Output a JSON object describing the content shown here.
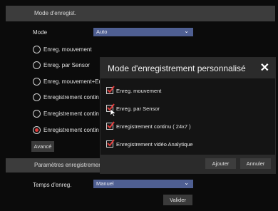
{
  "record_mode_section": {
    "title": "Mode d'enregist.",
    "mode_label": "Mode",
    "mode_value": "Auto",
    "options": [
      {
        "label": "Enreg. mouvement",
        "selected": false
      },
      {
        "label": "Enreg. par Sensor",
        "selected": false
      },
      {
        "label": "Enreg. mouvement+Er",
        "selected": false
      },
      {
        "label": "Enregistrement contin",
        "selected": false
      },
      {
        "label": "Enregistrement contin",
        "selected": false
      },
      {
        "label": "Enregistrement contin",
        "selected": true
      }
    ],
    "advanced_label": "Avancé"
  },
  "record_params_section": {
    "title": "Paramètres enregistremer",
    "time_label": "Temps d'enreg.",
    "time_value": "Manuel",
    "apply_label": "Valider"
  },
  "modal": {
    "title": "Mode d'enregistrement personnalisé",
    "items": [
      {
        "label": "Enreg. mouvement",
        "checked": true
      },
      {
        "label": "Enreg. par Sensor",
        "checked": true
      },
      {
        "label": "Enregistrement continu  ( 24x7 )",
        "checked": true
      },
      {
        "label": "Enregistrement vidéo Analytique",
        "checked": true
      }
    ],
    "add_label": "Ajouter",
    "cancel_label": "Annuler"
  },
  "colors": {
    "accent_select": "#4f5f92",
    "check_red": "#e03a3a"
  }
}
